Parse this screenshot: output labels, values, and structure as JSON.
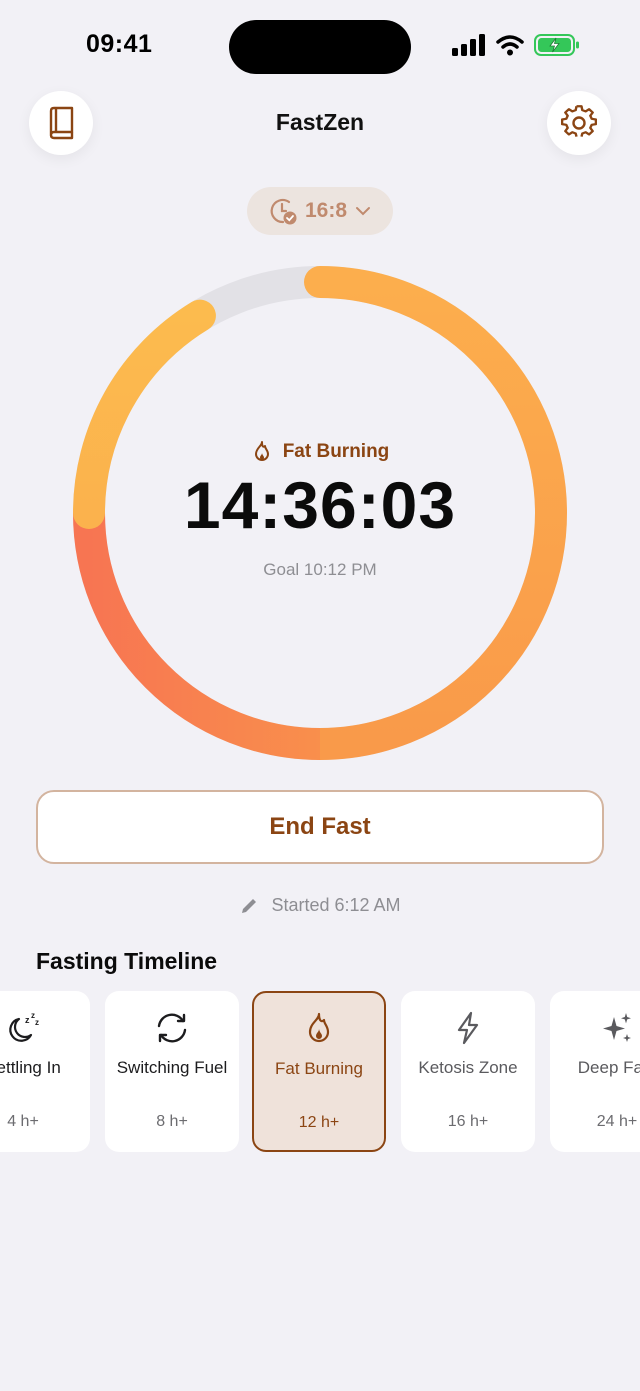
{
  "status_bar": {
    "time": "09:41"
  },
  "header": {
    "title": "FastZen"
  },
  "plan": {
    "label": "16:8"
  },
  "timer": {
    "stage": "Fat Burning",
    "elapsed": "14:36:03",
    "goal": "Goal 10:12 PM",
    "progress_fraction": 0.913
  },
  "actions": {
    "end_label": "End Fast",
    "started": "Started 6:12 AM"
  },
  "timeline": {
    "title": "Fasting Timeline",
    "stages": [
      {
        "name": "Settling In",
        "hours": "4 h+",
        "icon": "moon-zzz-icon"
      },
      {
        "name": "Switching Fuel",
        "hours": "8 h+",
        "icon": "refresh-icon"
      },
      {
        "name": "Fat Burning",
        "hours": "12 h+",
        "icon": "flame-icon",
        "active": true
      },
      {
        "name": "Ketosis Zone",
        "hours": "16 h+",
        "icon": "bolt-icon"
      },
      {
        "name": "Deep Fast",
        "hours": "24 h+",
        "icon": "sparkles-icon"
      }
    ]
  },
  "colors": {
    "accent": "#8b4513",
    "ring_track": "#e2e1e6",
    "ring_yellow": "#fbb84e",
    "ring_orange": "#f99a4a",
    "ring_coral": "#f77a52",
    "background": "#f2f1f6"
  }
}
